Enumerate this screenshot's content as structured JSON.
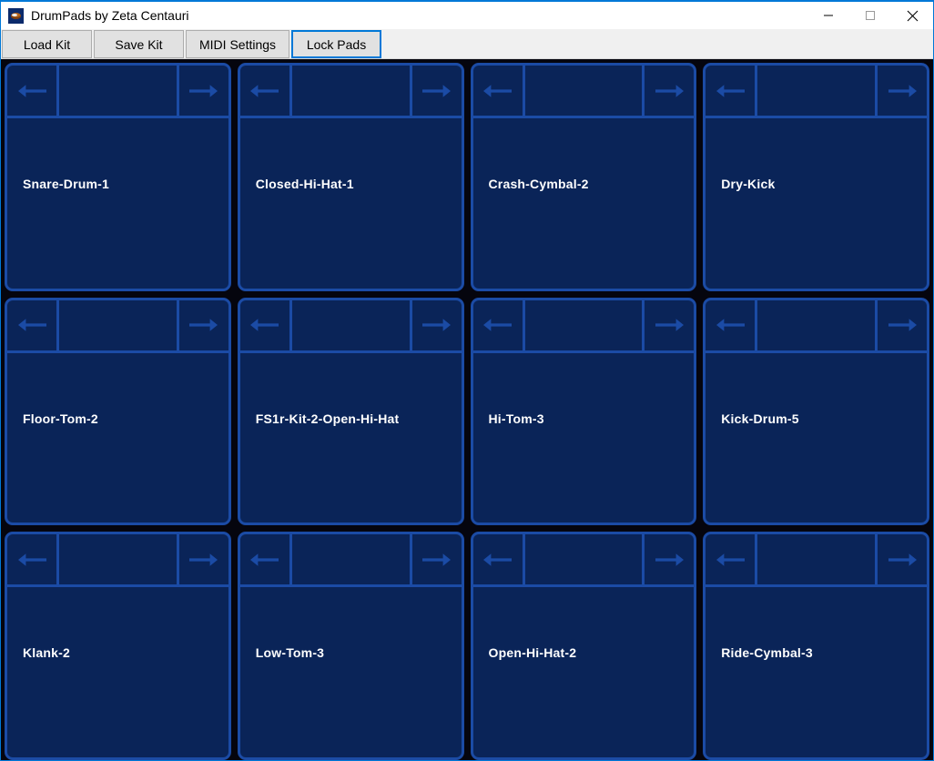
{
  "window": {
    "title": "DrumPads by Zeta Centauri",
    "icon": "drum-app-icon",
    "controls": {
      "minimize": "minimize-icon",
      "maximize": "maximize-icon",
      "close": "close-icon"
    },
    "accent_color": "#0078d7"
  },
  "toolbar": {
    "buttons": [
      {
        "label": "Load Kit",
        "focused": false
      },
      {
        "label": "Save Kit",
        "focused": false
      },
      {
        "label": "MIDI Settings",
        "focused": false
      },
      {
        "label": "Lock Pads",
        "focused": true
      }
    ]
  },
  "pads": {
    "colors": {
      "background": "#05050e",
      "pad_fill": "#0a2458",
      "pad_border": "#1b4ba5",
      "arrow": "#1b4ba5",
      "label": "#ffffff"
    },
    "prev_icon": "arrow-left-icon",
    "next_icon": "arrow-right-icon",
    "items": [
      {
        "label": "Snare-Drum-1"
      },
      {
        "label": "Closed-Hi-Hat-1"
      },
      {
        "label": "Crash-Cymbal-2"
      },
      {
        "label": "Dry-Kick"
      },
      {
        "label": "Floor-Tom-2"
      },
      {
        "label": "FS1r-Kit-2-Open-Hi-Hat"
      },
      {
        "label": "Hi-Tom-3"
      },
      {
        "label": "Kick-Drum-5"
      },
      {
        "label": "Klank-2"
      },
      {
        "label": "Low-Tom-3"
      },
      {
        "label": "Open-Hi-Hat-2"
      },
      {
        "label": "Ride-Cymbal-3"
      }
    ]
  }
}
